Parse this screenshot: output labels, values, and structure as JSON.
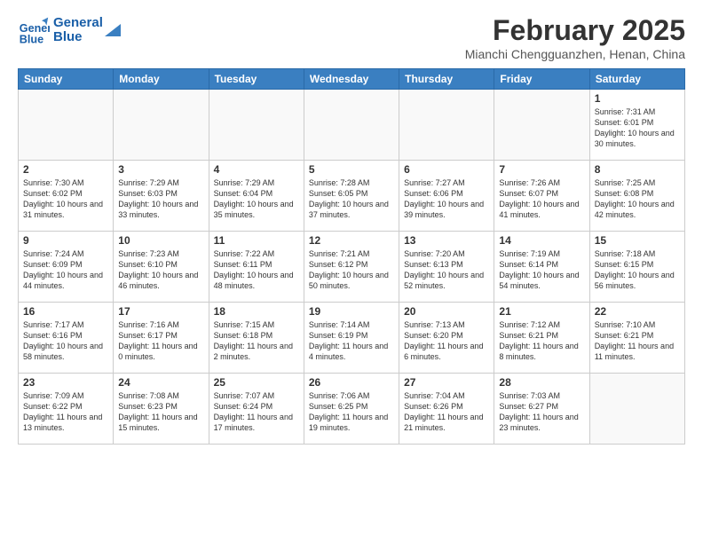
{
  "header": {
    "logo_line1": "General",
    "logo_line2": "Blue",
    "month_title": "February 2025",
    "location": "Mianchi Chengguanzhen, Henan, China"
  },
  "days_of_week": [
    "Sunday",
    "Monday",
    "Tuesday",
    "Wednesday",
    "Thursday",
    "Friday",
    "Saturday"
  ],
  "weeks": [
    [
      {
        "day": "",
        "content": ""
      },
      {
        "day": "",
        "content": ""
      },
      {
        "day": "",
        "content": ""
      },
      {
        "day": "",
        "content": ""
      },
      {
        "day": "",
        "content": ""
      },
      {
        "day": "",
        "content": ""
      },
      {
        "day": "1",
        "content": "Sunrise: 7:31 AM\nSunset: 6:01 PM\nDaylight: 10 hours and 30 minutes."
      }
    ],
    [
      {
        "day": "2",
        "content": "Sunrise: 7:30 AM\nSunset: 6:02 PM\nDaylight: 10 hours and 31 minutes."
      },
      {
        "day": "3",
        "content": "Sunrise: 7:29 AM\nSunset: 6:03 PM\nDaylight: 10 hours and 33 minutes."
      },
      {
        "day": "4",
        "content": "Sunrise: 7:29 AM\nSunset: 6:04 PM\nDaylight: 10 hours and 35 minutes."
      },
      {
        "day": "5",
        "content": "Sunrise: 7:28 AM\nSunset: 6:05 PM\nDaylight: 10 hours and 37 minutes."
      },
      {
        "day": "6",
        "content": "Sunrise: 7:27 AM\nSunset: 6:06 PM\nDaylight: 10 hours and 39 minutes."
      },
      {
        "day": "7",
        "content": "Sunrise: 7:26 AM\nSunset: 6:07 PM\nDaylight: 10 hours and 41 minutes."
      },
      {
        "day": "8",
        "content": "Sunrise: 7:25 AM\nSunset: 6:08 PM\nDaylight: 10 hours and 42 minutes."
      }
    ],
    [
      {
        "day": "9",
        "content": "Sunrise: 7:24 AM\nSunset: 6:09 PM\nDaylight: 10 hours and 44 minutes."
      },
      {
        "day": "10",
        "content": "Sunrise: 7:23 AM\nSunset: 6:10 PM\nDaylight: 10 hours and 46 minutes."
      },
      {
        "day": "11",
        "content": "Sunrise: 7:22 AM\nSunset: 6:11 PM\nDaylight: 10 hours and 48 minutes."
      },
      {
        "day": "12",
        "content": "Sunrise: 7:21 AM\nSunset: 6:12 PM\nDaylight: 10 hours and 50 minutes."
      },
      {
        "day": "13",
        "content": "Sunrise: 7:20 AM\nSunset: 6:13 PM\nDaylight: 10 hours and 52 minutes."
      },
      {
        "day": "14",
        "content": "Sunrise: 7:19 AM\nSunset: 6:14 PM\nDaylight: 10 hours and 54 minutes."
      },
      {
        "day": "15",
        "content": "Sunrise: 7:18 AM\nSunset: 6:15 PM\nDaylight: 10 hours and 56 minutes."
      }
    ],
    [
      {
        "day": "16",
        "content": "Sunrise: 7:17 AM\nSunset: 6:16 PM\nDaylight: 10 hours and 58 minutes."
      },
      {
        "day": "17",
        "content": "Sunrise: 7:16 AM\nSunset: 6:17 PM\nDaylight: 11 hours and 0 minutes."
      },
      {
        "day": "18",
        "content": "Sunrise: 7:15 AM\nSunset: 6:18 PM\nDaylight: 11 hours and 2 minutes."
      },
      {
        "day": "19",
        "content": "Sunrise: 7:14 AM\nSunset: 6:19 PM\nDaylight: 11 hours and 4 minutes."
      },
      {
        "day": "20",
        "content": "Sunrise: 7:13 AM\nSunset: 6:20 PM\nDaylight: 11 hours and 6 minutes."
      },
      {
        "day": "21",
        "content": "Sunrise: 7:12 AM\nSunset: 6:21 PM\nDaylight: 11 hours and 8 minutes."
      },
      {
        "day": "22",
        "content": "Sunrise: 7:10 AM\nSunset: 6:21 PM\nDaylight: 11 hours and 11 minutes."
      }
    ],
    [
      {
        "day": "23",
        "content": "Sunrise: 7:09 AM\nSunset: 6:22 PM\nDaylight: 11 hours and 13 minutes."
      },
      {
        "day": "24",
        "content": "Sunrise: 7:08 AM\nSunset: 6:23 PM\nDaylight: 11 hours and 15 minutes."
      },
      {
        "day": "25",
        "content": "Sunrise: 7:07 AM\nSunset: 6:24 PM\nDaylight: 11 hours and 17 minutes."
      },
      {
        "day": "26",
        "content": "Sunrise: 7:06 AM\nSunset: 6:25 PM\nDaylight: 11 hours and 19 minutes."
      },
      {
        "day": "27",
        "content": "Sunrise: 7:04 AM\nSunset: 6:26 PM\nDaylight: 11 hours and 21 minutes."
      },
      {
        "day": "28",
        "content": "Sunrise: 7:03 AM\nSunset: 6:27 PM\nDaylight: 11 hours and 23 minutes."
      },
      {
        "day": "",
        "content": ""
      }
    ]
  ]
}
